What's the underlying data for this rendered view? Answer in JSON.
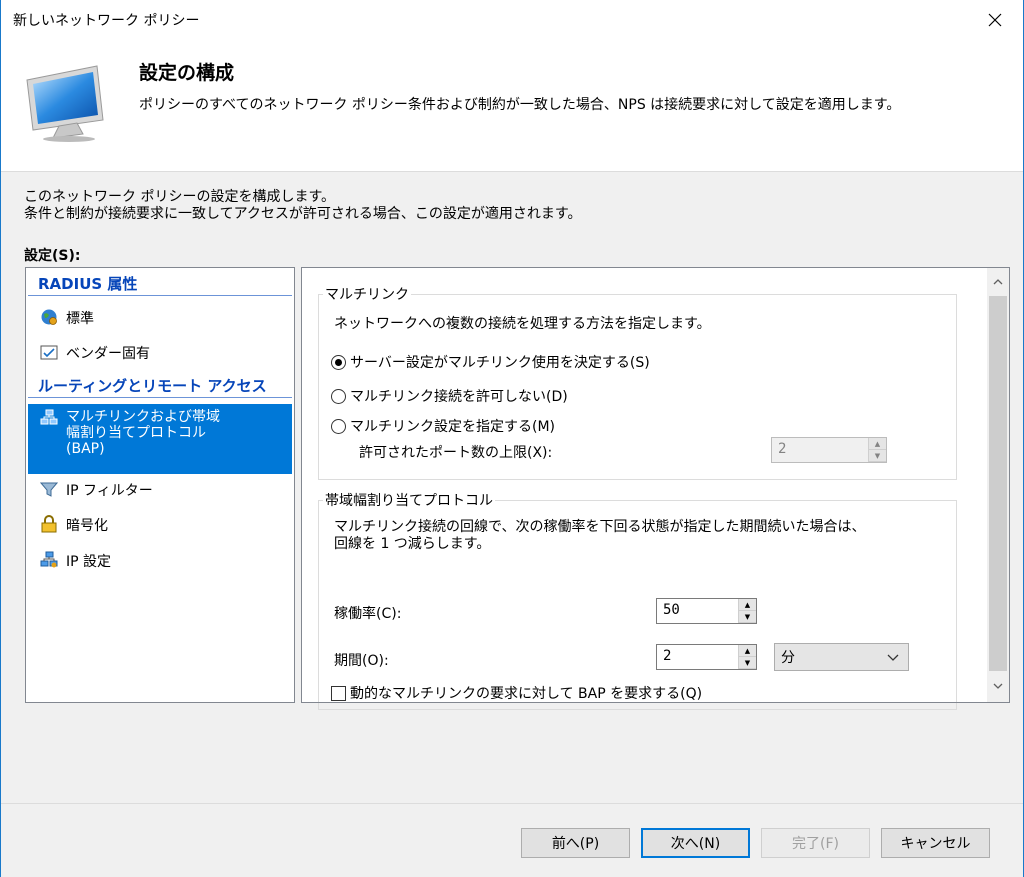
{
  "window": {
    "title": "新しいネットワーク ポリシー"
  },
  "header": {
    "title": "設定の構成",
    "description": "ポリシーのすべてのネットワーク ポリシー条件および制約が一致した場合、NPS は接続要求に対して設定を適用します。"
  },
  "intro": {
    "line1": "このネットワーク ポリシーの設定を構成します。",
    "line2": "条件と制約が接続要求に一致してアクセスが許可される場合、この設定が適用されます。"
  },
  "settings_label": "設定(S):",
  "nav": {
    "group1": "RADIUS 属性",
    "standard": "標準",
    "vendor": "ベンダー固有",
    "group2": "ルーティングとリモート アクセス",
    "multilink_l1": "マルチリンクおよび帯域",
    "multilink_l2": "幅割り当てプロトコル",
    "multilink_l3": "(BAP)",
    "ip_filter": "IP フィルター",
    "encryption": "暗号化",
    "ip_settings": "IP 設定"
  },
  "multilink": {
    "legend": "マルチリンク",
    "description": "ネットワークへの複数の接続を処理する方法を指定します。",
    "opt_server": "サーバー設定がマルチリンク使用を決定する(S)",
    "opt_disallow": "マルチリンク接続を許可しない(D)",
    "opt_specify": "マルチリンク設定を指定する(M)",
    "max_ports_label": "許可されたポート数の上限(X):",
    "max_ports_value": "2",
    "selected_option": "server"
  },
  "bap": {
    "legend": "帯域幅割り当てプロトコル",
    "desc1": "マルチリンク接続の回線で、次の稼働率を下回る状態が指定した期間続いた場合は、",
    "desc2": "回線を 1 つ減らします。",
    "utilization_label": "稼働率(C):",
    "utilization_value": "50",
    "period_label": "期間(O):",
    "period_value": "2",
    "period_unit": "分",
    "require_bap": "動的なマルチリンクの要求に対して BAP を要求する(Q)",
    "require_bap_checked": false
  },
  "buttons": {
    "prev": "前へ(P)",
    "next": "次へ(N)",
    "finish": "完了(F)",
    "cancel": "キャンセル"
  }
}
